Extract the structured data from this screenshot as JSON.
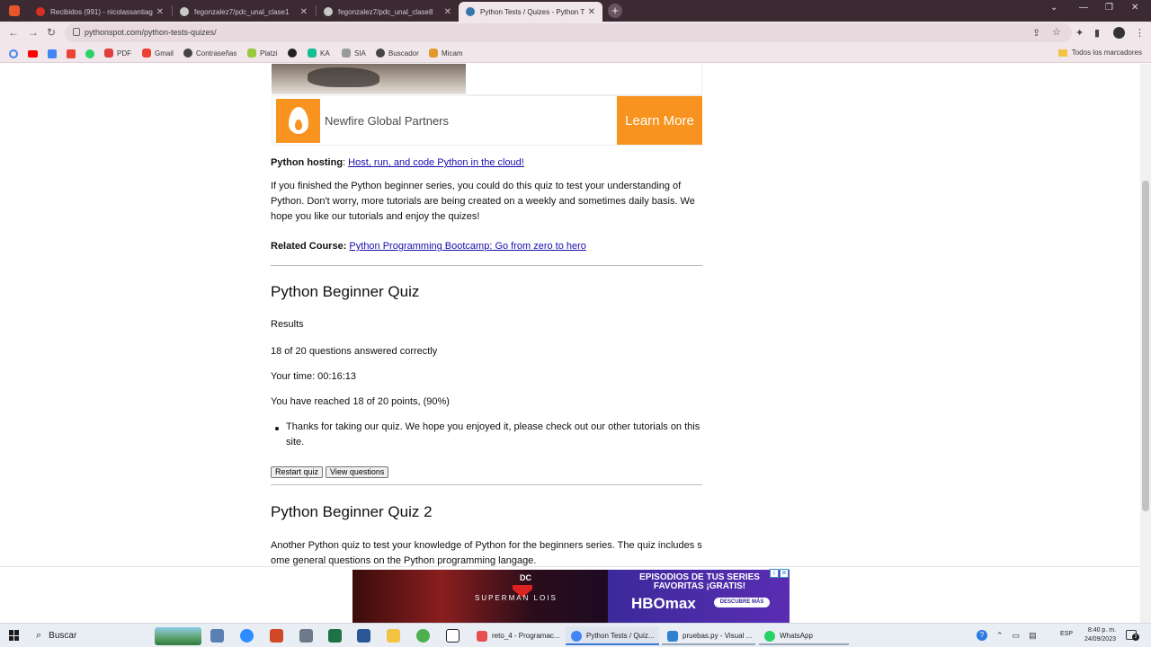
{
  "browser": {
    "tabs": [
      {
        "title": "Recibidos (991) - nicolassantiag",
        "color": "#d93025"
      },
      {
        "title": "fegonzalez7/pdc_unal_clase1",
        "color": "#c9c9c9"
      },
      {
        "title": "fegonzalez7/pdc_unal_clase8",
        "color": "#c9c9c9"
      },
      {
        "title": "Python Tests / Quizes - Python T",
        "color": "#3776ab"
      }
    ],
    "new_tab": "+",
    "url": "pythonspot.com/python-tests-quizes/",
    "bookmarks": [
      "PDF",
      "Gmail",
      "Contraseñas",
      "Platzi",
      "",
      "KA",
      "SIA",
      "Buscador",
      "Micam"
    ],
    "all_bookmarks": "Todos los marcadores"
  },
  "ad": {
    "company": "Newfire Global Partners",
    "cta": "Learn More",
    "brand_color": "#f7931e"
  },
  "page": {
    "hosting_label": "Python hosting",
    "hosting_sep": ":",
    "hosting_link": "Host, run, and code Python in the cloud!",
    "intro": "If you finished the Python beginner series, you could do this quiz to test your understanding of Python. Don't worry, more tutorials are being created on a weekly and sometimes daily basis. We hope you like our tutorials and enjoy the quizes!",
    "related_label": "Related Course:",
    "related_link": "Python Programming Bootcamp: Go from zero to hero",
    "quiz1": {
      "title": "Python Beginner Quiz",
      "results_label": "Results",
      "answered": "18 of 20 questions answered correctly",
      "time": "Your time: 00:16:13",
      "points": "You have reached 18 of 20 points, (90%)",
      "message": "Thanks for taking our quiz. We hope you enjoyed it, please check out our other tutorials on this site.",
      "restart": "Restart quiz",
      "view": "View questions"
    },
    "quiz2": {
      "title": "Python Beginner Quiz 2",
      "desc": "Another Python quiz to test your knowledge of Python for the beginners series. The quiz includes some general questions on the Python programming langage."
    },
    "collapse_icon": "chevron-down-icon"
  },
  "bottom_ad": {
    "dc": "DC",
    "show": "SUPERMAN LOIS",
    "headline": "EPISODIOS DE TUS SERIES FAVORITAS ¡GRATIS!",
    "logo": "HBOmax",
    "cta": "DESCUBRE MÁS"
  },
  "taskbar": {
    "search": "Buscar",
    "tasks": [
      {
        "label": "reto_4 - Programac...",
        "color": "#e94f4f"
      },
      {
        "label": "Python Tests / Quiz...",
        "color": "#4285f4"
      },
      {
        "label": "pruebas.py - Visual ...",
        "color": "#2f80d1"
      },
      {
        "label": "WhatsApp",
        "color": "#25d366"
      }
    ],
    "lang": "ESP",
    "time": "8:40 p. m.",
    "date": "24/09/2023",
    "notifications": "2"
  }
}
